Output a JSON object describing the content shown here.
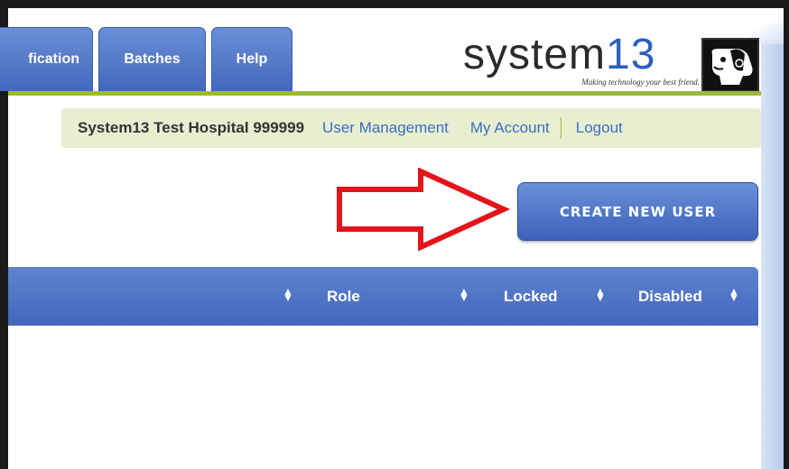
{
  "nav": {
    "tabs": [
      {
        "label": "fication"
      },
      {
        "label": "Batches"
      },
      {
        "label": "Help"
      }
    ]
  },
  "logo": {
    "name_prefix": "system",
    "name_number": "13",
    "tagline": "Making technology your best friend."
  },
  "infobar": {
    "hospital": "System13 Test Hospital 999999",
    "user_management": "User Management",
    "my_account": "My Account",
    "logout": "Logout"
  },
  "actions": {
    "create_new_user": "CREATE NEW USER"
  },
  "table": {
    "columns": [
      "Role",
      "Locked",
      "Disabled"
    ]
  },
  "colors": {
    "tab_blue": "#4466bb",
    "accent_green": "#9bb83c",
    "link_blue": "#3a6ec2",
    "arrow_red": "#e3141b"
  },
  "icons": {
    "sort": "sort-updown-icon",
    "mascot": "dog-icon",
    "annotation": "red-arrow"
  }
}
